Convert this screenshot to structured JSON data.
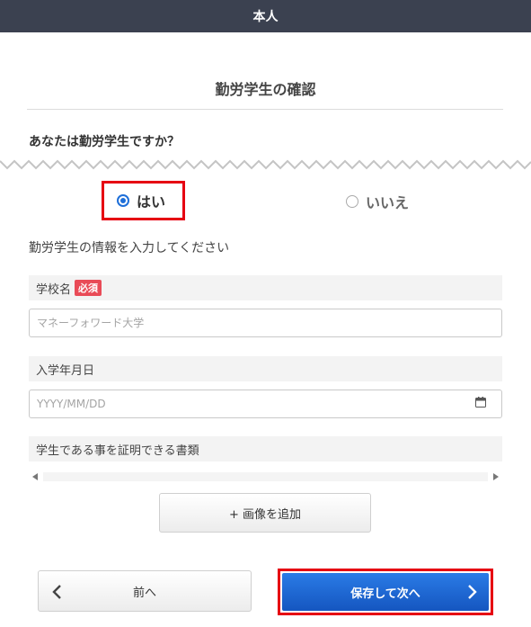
{
  "header": {
    "title": "本人"
  },
  "section": {
    "title": "勤労学生の確認"
  },
  "question": {
    "text": "あなたは勤労学生ですか？"
  },
  "answer": {
    "yes_label": "はい",
    "no_label": "いいえ",
    "selected": "はい"
  },
  "instruction": {
    "text": "勤労学生の情報を入力してください"
  },
  "form": {
    "school_name": {
      "label": "学校名",
      "required_badge": "必須",
      "placeholder": "マネーフォワード大学",
      "value": ""
    },
    "enrollment_date": {
      "label": "入学年月日",
      "placeholder": "YYYY/MM/DD",
      "value": ""
    },
    "document": {
      "label": "学生である事を証明できる書類"
    }
  },
  "buttons": {
    "add_image": "+ 画像を追加",
    "prev": "前へ",
    "save_next": "保存して次へ"
  },
  "icons": {
    "yes_radio": "radio-checked-icon",
    "no_radio": "radio-unchecked-icon",
    "calendar": "calendar-icon",
    "prev": "chevron-left-icon",
    "next": "chevron-right-icon"
  },
  "colors": {
    "header_bg": "#3b4150",
    "accent_blue": "#1e6fd9",
    "highlight_red": "#e60012",
    "required_badge": "#e94b57"
  }
}
